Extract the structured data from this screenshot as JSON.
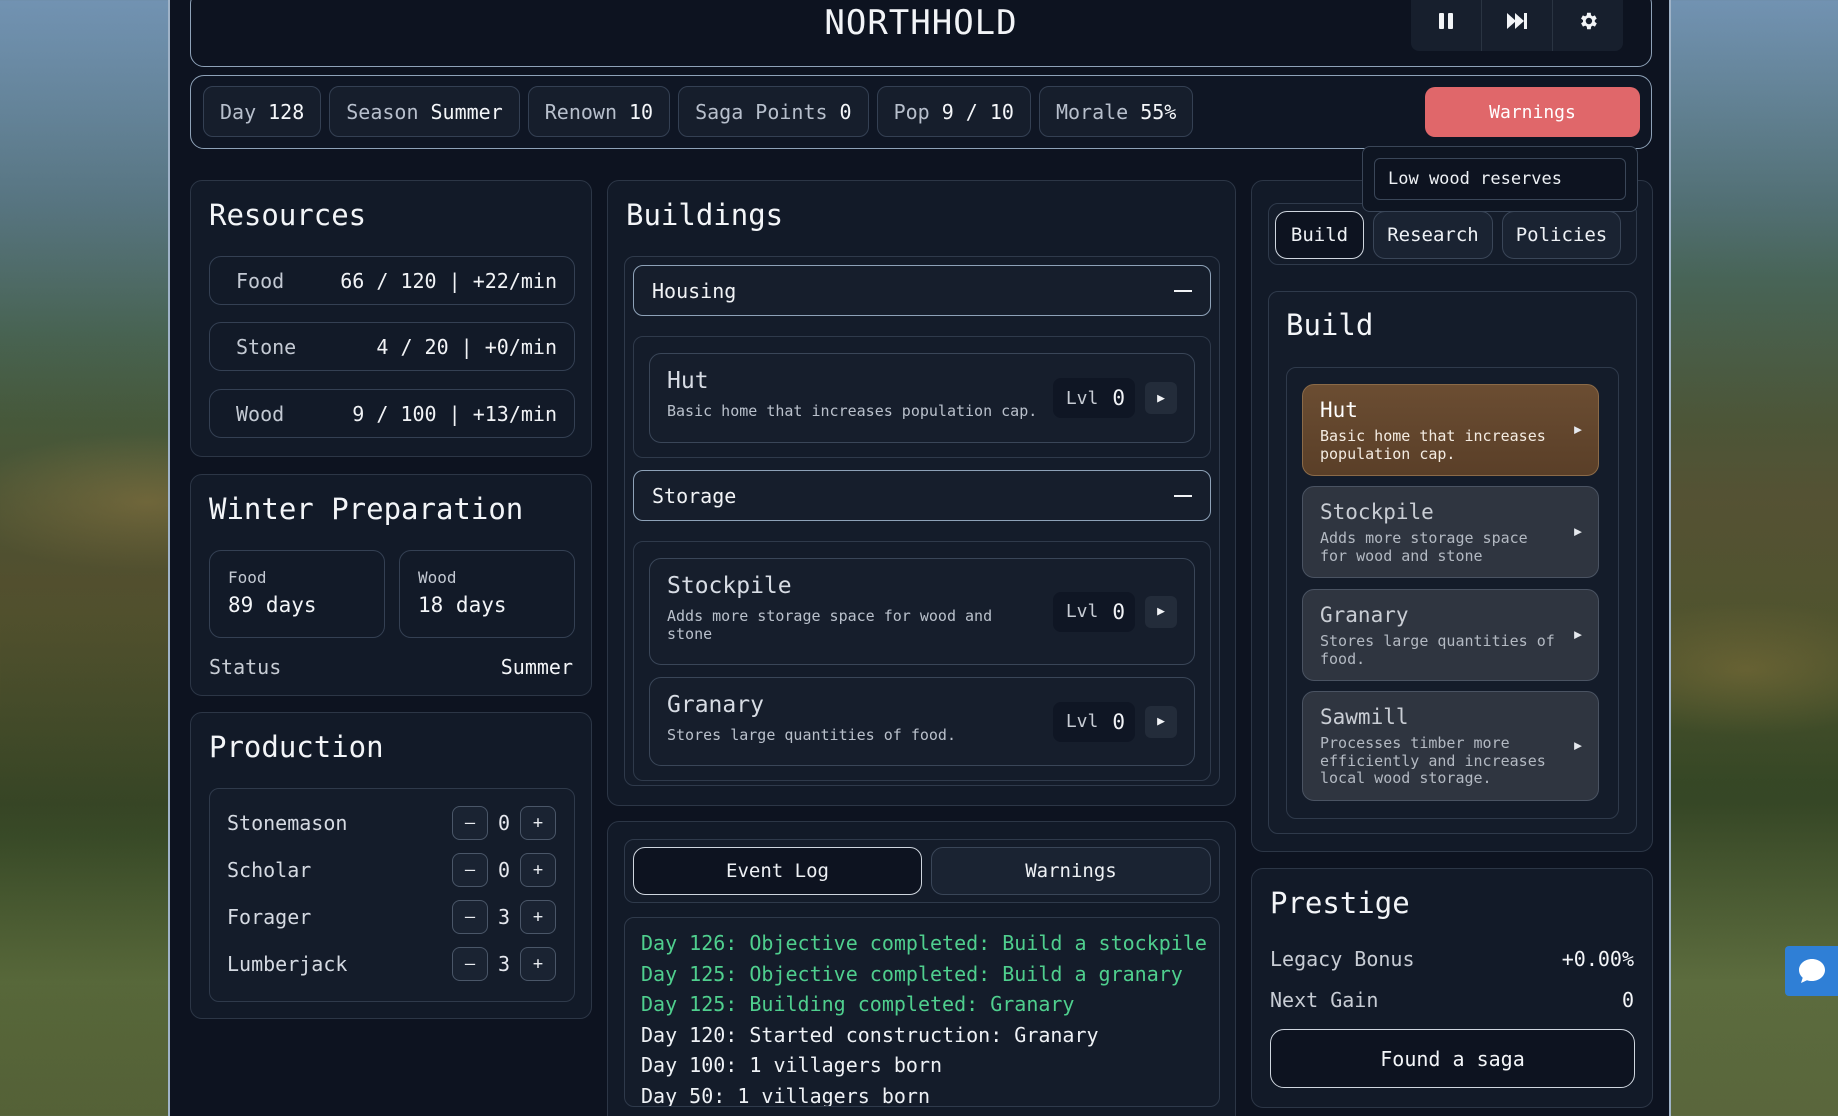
{
  "header": {
    "title": "NORTHHOLD",
    "controls": [
      "pause-icon",
      "fast-forward-icon",
      "gear-icon"
    ]
  },
  "stats": [
    {
      "label": "Day",
      "value": "128"
    },
    {
      "label": "Season",
      "value": "Summer"
    },
    {
      "label": "Renown",
      "value": "10"
    },
    {
      "label": "Saga Points",
      "value": "0"
    },
    {
      "label": "Pop",
      "value": "9 / 10"
    },
    {
      "label": "Morale",
      "value": "55%"
    }
  ],
  "warnings": {
    "button_label": "Warnings",
    "popover_items": [
      "Low wood reserves"
    ],
    "color": "#e0676a"
  },
  "resources": {
    "title": "Resources",
    "rows": [
      {
        "name": "Food",
        "value": "66 / 120 | +22/min"
      },
      {
        "name": "Stone",
        "value": "4 / 20 | +0/min"
      },
      {
        "name": "Wood",
        "value": "9 / 100 | +13/min"
      }
    ]
  },
  "winter": {
    "title": "Winter Preparation",
    "boxes": [
      {
        "label": "Food",
        "value": "89 days"
      },
      {
        "label": "Wood",
        "value": "18 days"
      }
    ],
    "status_label": "Status",
    "status_value": "Summer"
  },
  "production": {
    "title": "Production",
    "rows": [
      {
        "name": "Stonemason",
        "count": "0",
        "minus": "–",
        "plus": "+"
      },
      {
        "name": "Scholar",
        "count": "0",
        "minus": "–",
        "plus": "+"
      },
      {
        "name": "Forager",
        "count": "3",
        "minus": "–",
        "plus": "+"
      },
      {
        "name": "Lumberjack",
        "count": "3",
        "minus": "–",
        "plus": "+"
      }
    ]
  },
  "buildings": {
    "title": "Buildings",
    "groups": [
      {
        "name": "Housing",
        "items": [
          {
            "name": "Hut",
            "desc": "Basic home that increases population cap.",
            "lvl_label": "Lvl",
            "lvl": "0"
          }
        ]
      },
      {
        "name": "Storage",
        "items": [
          {
            "name": "Stockpile",
            "desc": "Adds more storage space for wood and stone",
            "lvl_label": "Lvl",
            "lvl": "0"
          },
          {
            "name": "Granary",
            "desc": "Stores large quantities of food.",
            "lvl_label": "Lvl",
            "lvl": "0"
          }
        ]
      }
    ]
  },
  "log": {
    "tabs": [
      "Event Log",
      "Warnings"
    ],
    "active_tab": "Event Log",
    "lines": [
      {
        "text": "Day 126: Objective completed: Build a stockpile",
        "color": "green"
      },
      {
        "text": "Day 125: Objective completed: Build a granary",
        "color": "green"
      },
      {
        "text": "Day 125: Building completed: Granary",
        "color": "green"
      },
      {
        "text": "Day 120: Started construction: Granary",
        "color": "white"
      },
      {
        "text": "Day 100: 1 villagers born",
        "color": "white"
      },
      {
        "text": "Day 50: 1 villagers born",
        "color": "white"
      }
    ]
  },
  "right_tabs": {
    "tabs": [
      "Build",
      "Research",
      "Policies"
    ],
    "active": "Build"
  },
  "build": {
    "title": "Build",
    "options": [
      {
        "name": "Hut",
        "desc": "Basic home that increases population cap.",
        "selected": true
      },
      {
        "name": "Stockpile",
        "desc": "Adds more storage space for wood and stone",
        "selected": false
      },
      {
        "name": "Granary",
        "desc": "Stores large quantities of food.",
        "selected": false
      },
      {
        "name": "Sawmill",
        "desc": "Processes timber more efficiently and increases local wood storage.",
        "selected": false
      }
    ]
  },
  "prestige": {
    "title": "Prestige",
    "legacy_label": "Legacy Bonus",
    "legacy_value": "+0.00%",
    "next_label": "Next Gain",
    "next_value": "0",
    "button_label": "Found a saga"
  }
}
